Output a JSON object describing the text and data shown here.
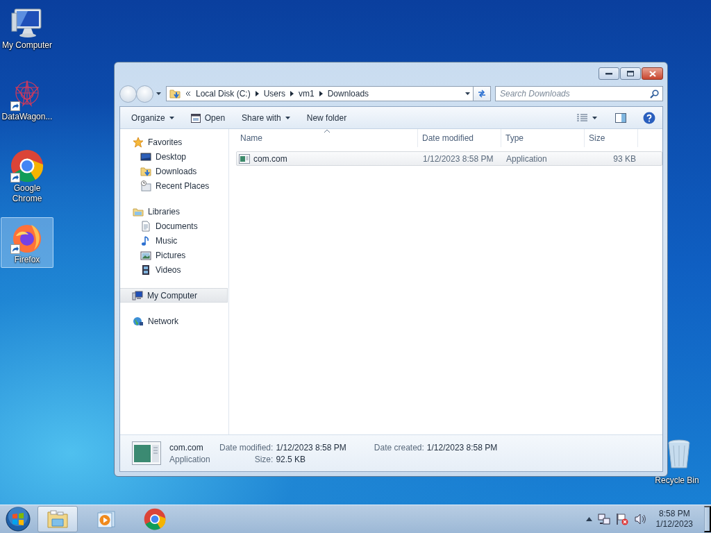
{
  "desktop_icons": [
    {
      "label": "My Computer",
      "kind": "computer",
      "shortcut": false,
      "selected": false
    },
    {
      "label": "DataWagon...",
      "kind": "datawagon",
      "shortcut": true,
      "selected": false
    },
    {
      "label": "Google Chrome",
      "kind": "chrome",
      "shortcut": true,
      "selected": false
    },
    {
      "label": "Firefox",
      "kind": "firefox",
      "shortcut": true,
      "selected": true
    }
  ],
  "recycle_bin": {
    "label": "Recycle Bin"
  },
  "window": {
    "breadcrumb": [
      "Local Disk (C:)",
      "Users",
      "vm1",
      "Downloads"
    ],
    "search": {
      "placeholder": "Search Downloads"
    },
    "toolbar": [
      {
        "label": "Organize",
        "kind": "dropdown"
      },
      {
        "label": "Open",
        "kind": "icon"
      },
      {
        "label": "Share with",
        "kind": "dropdown"
      },
      {
        "label": "New folder",
        "kind": "plain"
      }
    ],
    "nav": [
      {
        "label": "Favorites",
        "kind": "favorites",
        "selected": false,
        "children": [
          {
            "label": "Desktop",
            "kind": "desktop",
            "selected": false
          },
          {
            "label": "Downloads",
            "kind": "downloads",
            "selected": false
          },
          {
            "label": "Recent Places",
            "kind": "recent",
            "selected": false
          }
        ]
      },
      {
        "label": "Libraries",
        "kind": "libraries",
        "selected": false,
        "children": [
          {
            "label": "Documents",
            "kind": "documents",
            "selected": false
          },
          {
            "label": "Music",
            "kind": "music",
            "selected": false
          },
          {
            "label": "Pictures",
            "kind": "pictures",
            "selected": false
          },
          {
            "label": "Videos",
            "kind": "videos",
            "selected": false
          }
        ]
      },
      {
        "label": "My Computer",
        "kind": "computer",
        "selected": true
      },
      {
        "label": "Network",
        "kind": "network",
        "selected": false
      }
    ],
    "columns": [
      {
        "label": "Name",
        "sorted": true
      },
      {
        "label": "Date modified",
        "sorted": false
      },
      {
        "label": "Type",
        "sorted": false
      },
      {
        "label": "Size",
        "sorted": false
      }
    ],
    "rows": [
      {
        "name": "com.com",
        "date_modified": "1/12/2023 8:58 PM",
        "type": "Application",
        "size": "93 KB",
        "selected": true
      }
    ],
    "details": {
      "name": "com.com",
      "type": "Application",
      "columns": [
        [
          {
            "label": "Date modified:",
            "value": "1/12/2023 8:58 PM"
          },
          {
            "label": "Size:",
            "value": "92.5 KB"
          }
        ],
        [
          {
            "label": "Date created:",
            "value": "1/12/2023 8:58 PM"
          }
        ]
      ]
    }
  },
  "taskbar": {
    "items": [
      {
        "kind": "explorer",
        "active": true
      },
      {
        "kind": "media",
        "active": false
      },
      {
        "kind": "chrome",
        "active": false
      }
    ],
    "clock": {
      "time": "8:58 PM",
      "date": "1/12/2023"
    }
  }
}
